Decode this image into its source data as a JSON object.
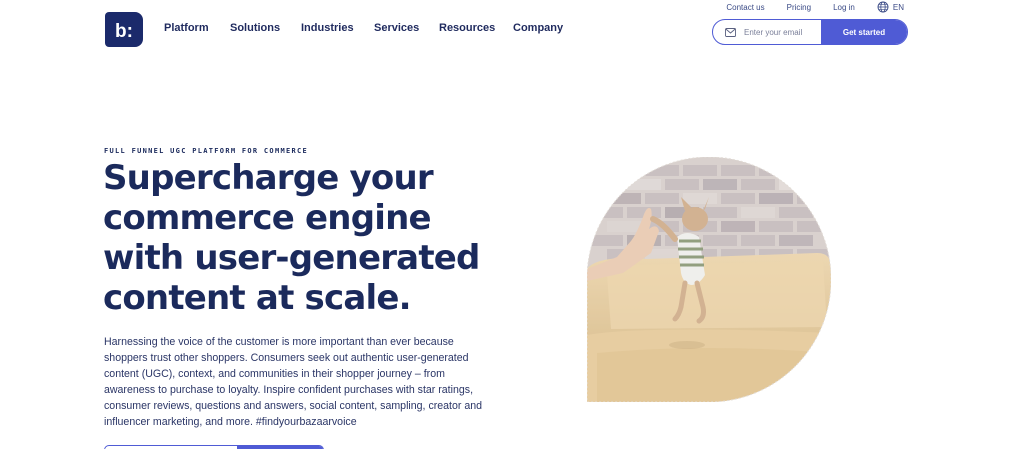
{
  "header": {
    "top_links": [
      "Contact us",
      "Pricing",
      "Log in"
    ],
    "language": "EN",
    "nav": [
      "Platform",
      "Solutions",
      "Industries",
      "Services",
      "Resources",
      "Company"
    ],
    "email_placeholder": "Enter your email",
    "cta_label": "Get started",
    "brand_color": "#4f5bd5",
    "logo_text": "b:"
  },
  "hero": {
    "eyebrow": "FULL FUNNEL UGC PLATFORM FOR COMMERCE",
    "headline_lines": [
      "Supercharge your",
      "commerce engine",
      "with user-generated",
      "content at scale."
    ],
    "body": "Harnessing the voice of the customer is more important than ever because shoppers trust other shoppers. Consumers seek out authentic user-generated content (UGC), context, and communities in their shopper journey – from awareness to purchase to loyalty. Inspire confident purchases with star ratings, consumer reviews, questions and answers, social content, sampling, creator and influencer marketing, and more. #findyourbazaarvoice"
  },
  "icons": {
    "globe": "globe-icon",
    "mail": "mail-icon",
    "hero_image": "dog-high-five-photo"
  }
}
